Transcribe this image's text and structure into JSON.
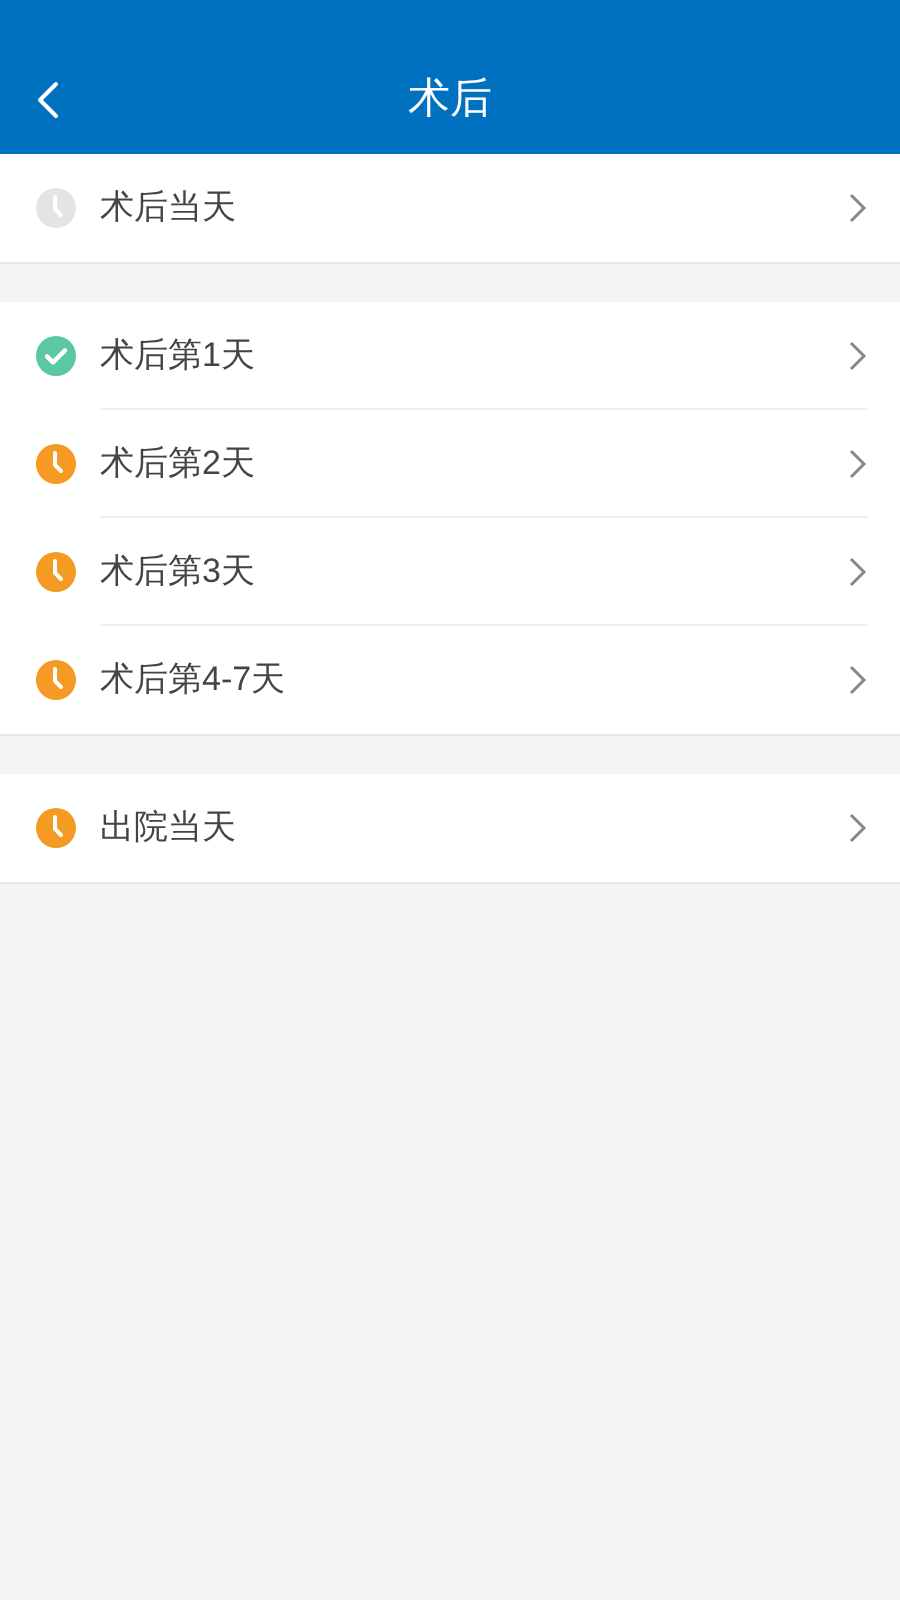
{
  "header": {
    "title": "术后"
  },
  "groups": [
    {
      "items": [
        {
          "label": "术后当天",
          "kind": "inactive"
        }
      ]
    },
    {
      "items": [
        {
          "label": "术后第1天",
          "kind": "done"
        },
        {
          "label": "术后第2天",
          "kind": "pending"
        },
        {
          "label": "术后第3天",
          "kind": "pending"
        },
        {
          "label": "术后第4-7天",
          "kind": "pending"
        }
      ]
    },
    {
      "items": [
        {
          "label": "出院当天",
          "kind": "pending"
        }
      ]
    }
  ]
}
